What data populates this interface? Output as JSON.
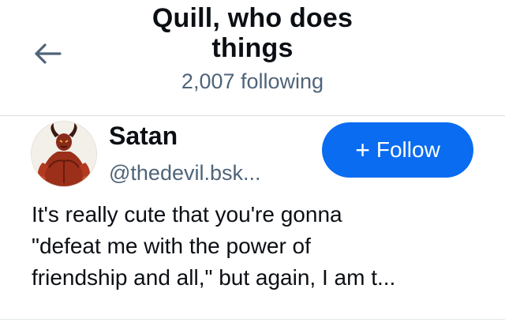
{
  "header": {
    "title_line1": "Quill, who does",
    "title_line2": "things",
    "following_count": "2,007 following",
    "back_icon": "arrow-left-icon"
  },
  "profile": {
    "display_name": "Satan",
    "handle": "@thedevil.bsk...",
    "avatar": "devil-avatar",
    "follow_label": "Follow",
    "follow_icon": "plus-icon",
    "bio_lines": [
      "It's really cute that you're gonna",
      "\"defeat me with the power of",
      "friendship and all,\" but again, I am t..."
    ]
  },
  "colors": {
    "accent": "#0a6cf0",
    "text_primary": "#0b0f14",
    "text_secondary": "#4f6479",
    "divider": "#d8dee4"
  }
}
